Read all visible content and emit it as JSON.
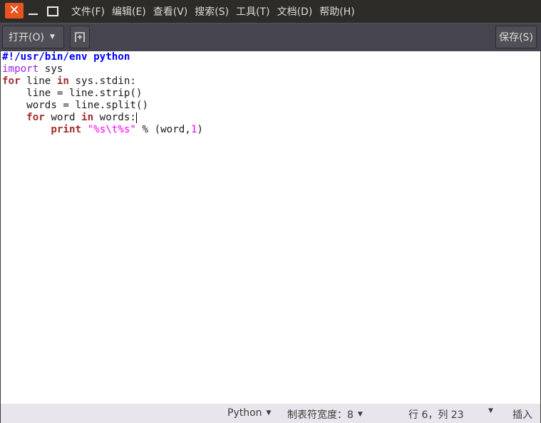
{
  "window": {
    "close_icon": "close-icon",
    "minimize_icon": "minimize-icon",
    "maximize_icon": "maximize-icon"
  },
  "menu": [
    "文件(F)",
    "编辑(E)",
    "查看(V)",
    "搜索(S)",
    "工具(T)",
    "文档(D)",
    "帮助(H)"
  ],
  "toolbar": {
    "open_label": "打开(O)",
    "new_tab_icon": "new-tab-icon",
    "save_label": "保存(S)"
  },
  "code": [
    [
      {
        "t": "#!/usr/bin/env python",
        "c": "shebang"
      }
    ],
    [
      {
        "t": "import",
        "c": "import"
      },
      {
        "t": " sys",
        "c": ""
      }
    ],
    [
      {
        "t": "for",
        "c": "kw"
      },
      {
        "t": " line ",
        "c": ""
      },
      {
        "t": "in",
        "c": "kw"
      },
      {
        "t": " sys.stdin:",
        "c": ""
      }
    ],
    [
      {
        "t": "    line = line.strip()",
        "c": ""
      }
    ],
    [
      {
        "t": "    words = line.split()",
        "c": ""
      }
    ],
    [
      {
        "t": "    ",
        "c": ""
      },
      {
        "t": "for",
        "c": "kw"
      },
      {
        "t": " word ",
        "c": ""
      },
      {
        "t": "in",
        "c": "kw"
      },
      {
        "t": " words:",
        "c": ""
      },
      {
        "t": "",
        "c": "cursor"
      }
    ],
    [
      {
        "t": "        ",
        "c": ""
      },
      {
        "t": "print",
        "c": "kw"
      },
      {
        "t": " ",
        "c": ""
      },
      {
        "t": "\"%s\\t%s\"",
        "c": "str"
      },
      {
        "t": " % (word,",
        "c": ""
      },
      {
        "t": "1",
        "c": "num"
      },
      {
        "t": ")",
        "c": ""
      }
    ]
  ],
  "status": {
    "language": "Python",
    "tab_width": "制表符宽度：8",
    "position": "行 6，列 23",
    "mode": "插入"
  },
  "colors": {
    "accent": "#e95420",
    "keyword": "#a52a2a",
    "import": "#a020f0",
    "shebang": "#0000ff",
    "string": "#ff00ff"
  }
}
